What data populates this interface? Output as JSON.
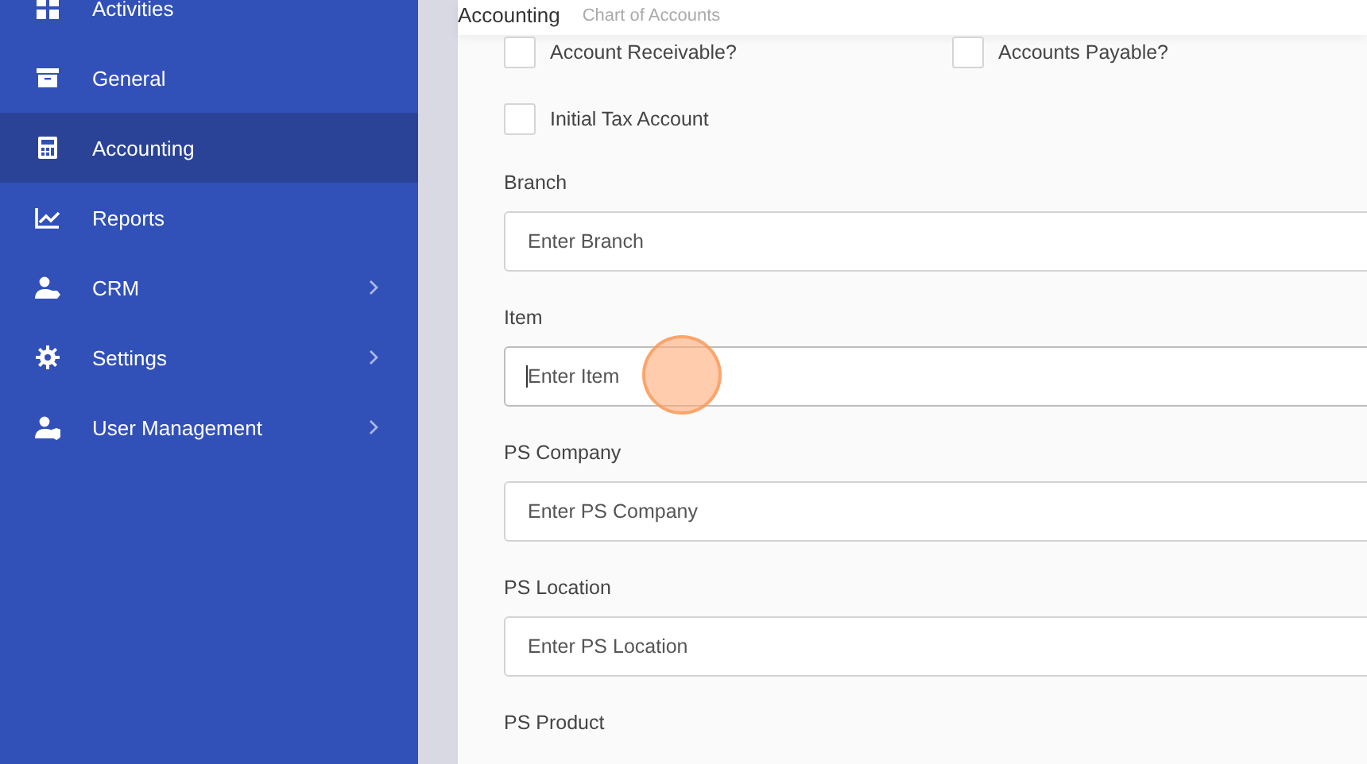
{
  "sidebar": {
    "items": [
      {
        "label": "Activities",
        "selected": false,
        "has_submenu": false
      },
      {
        "label": "General",
        "selected": false,
        "has_submenu": false
      },
      {
        "label": "Accounting",
        "selected": true,
        "has_submenu": false
      },
      {
        "label": "Reports",
        "selected": false,
        "has_submenu": false
      },
      {
        "label": "CRM",
        "selected": false,
        "has_submenu": true
      },
      {
        "label": "Settings",
        "selected": false,
        "has_submenu": true
      },
      {
        "label": "User Management",
        "selected": false,
        "has_submenu": true
      }
    ]
  },
  "header": {
    "title": "Accounting",
    "breadcrumb": "Chart of Accounts"
  },
  "checkboxes": [
    {
      "label": "Account Receivable?",
      "checked": false
    },
    {
      "label": "Accounts Payable?",
      "checked": false
    },
    {
      "label": "Initial Tax Account",
      "checked": false
    }
  ],
  "fields": [
    {
      "label": "Branch",
      "placeholder": "Enter Branch",
      "focused": false
    },
    {
      "label": "Item",
      "placeholder": "Enter Item",
      "focused": true
    },
    {
      "label": "PS Company",
      "placeholder": "Enter PS Company",
      "focused": false
    },
    {
      "label": "PS Location",
      "placeholder": "Enter PS Location",
      "focused": false
    },
    {
      "label": "PS Product"
    }
  ]
}
